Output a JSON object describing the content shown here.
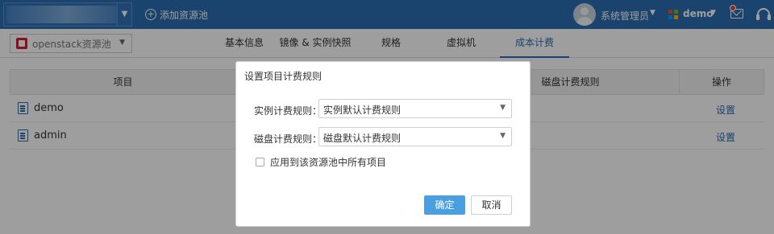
{
  "topbar": {
    "add_pool_label": "添加资源池",
    "user_name": "系统管理员",
    "project_name": "demo",
    "brand_color": "#2a6cb0",
    "project_icon_colors": [
      "#f25022",
      "#7fba00",
      "#00a4ef",
      "#ffb900"
    ],
    "notification_dot_color": "#e64340"
  },
  "subbar": {
    "pool_select_value": "openstack资源池",
    "tabs": [
      {
        "label": "基本信息",
        "active": false
      },
      {
        "label": "镜像 & 实例快照",
        "active": false
      },
      {
        "label": "规格",
        "active": false
      },
      {
        "label": "虚拟机",
        "active": false
      },
      {
        "label": "成本计费",
        "active": true
      }
    ]
  },
  "table": {
    "columns": [
      "项目",
      "磁盘计费规则",
      "操作"
    ],
    "rows": [
      {
        "name": "demo",
        "action": "设置"
      },
      {
        "name": "admin",
        "action": "设置"
      }
    ]
  },
  "dialog": {
    "title": "设置项目计费规则",
    "instance_rule_label": "实例计费规则：",
    "instance_rule_value": "实例默认计费规则",
    "disk_rule_label": "磁盘计费规则：",
    "disk_rule_value": "磁盘默认计费规则",
    "apply_all_label": "应用到该资源池中所有项目",
    "apply_all_checked": false,
    "confirm_label": "确定",
    "cancel_label": "取消",
    "confirm_color": "#4a9fe0"
  }
}
